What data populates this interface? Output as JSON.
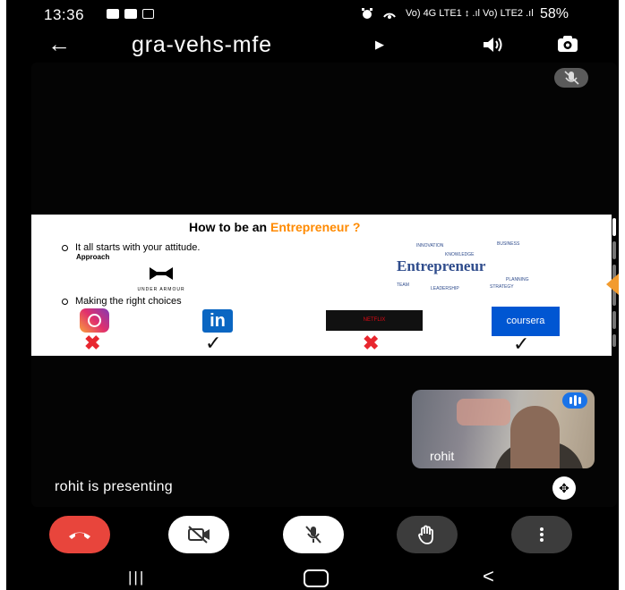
{
  "status_bar": {
    "time": "13:36",
    "network_text": "Vo) 4G LTE1 ↕ .ıl Vo) LTE2 .ıl",
    "battery": "58%"
  },
  "app_bar": {
    "title": "gra-vehs-mfe",
    "icons": [
      "back-arrow-icon",
      "caret-right-icon",
      "speaker-icon",
      "switch-camera-icon"
    ]
  },
  "slide": {
    "heading_prefix": "How to be an",
    "heading_accent": "Entrepreneur ?",
    "bullet1": "It all starts with your attitude.",
    "sub_label": "Approach",
    "under_armour_caption": "UNDER ARMOUR",
    "bullet2": "Making the right choices",
    "word_cloud": "Entrepreneur",
    "word_cloud_small": [
      "INNOVATION",
      "BUSINESS",
      "KNOWLEDGE",
      "PLANNING",
      "TEAM",
      "LEADERSHIP",
      "STRATEGY"
    ],
    "netflix_label": "NETFLIX",
    "coursera_label": "coursera",
    "linkedin_label": "in",
    "accent_color": "#ff8a00"
  },
  "participant": {
    "name": "rohit"
  },
  "presenting_text": "rohit is presenting",
  "controls": {
    "end_call_color": "#e8453c",
    "icons": [
      "end-call-icon",
      "camera-off-icon",
      "mic-off-icon",
      "raise-hand-icon",
      "more-options-icon"
    ]
  },
  "nav": {
    "recent_glyph": "|||",
    "back_glyph": "<"
  }
}
